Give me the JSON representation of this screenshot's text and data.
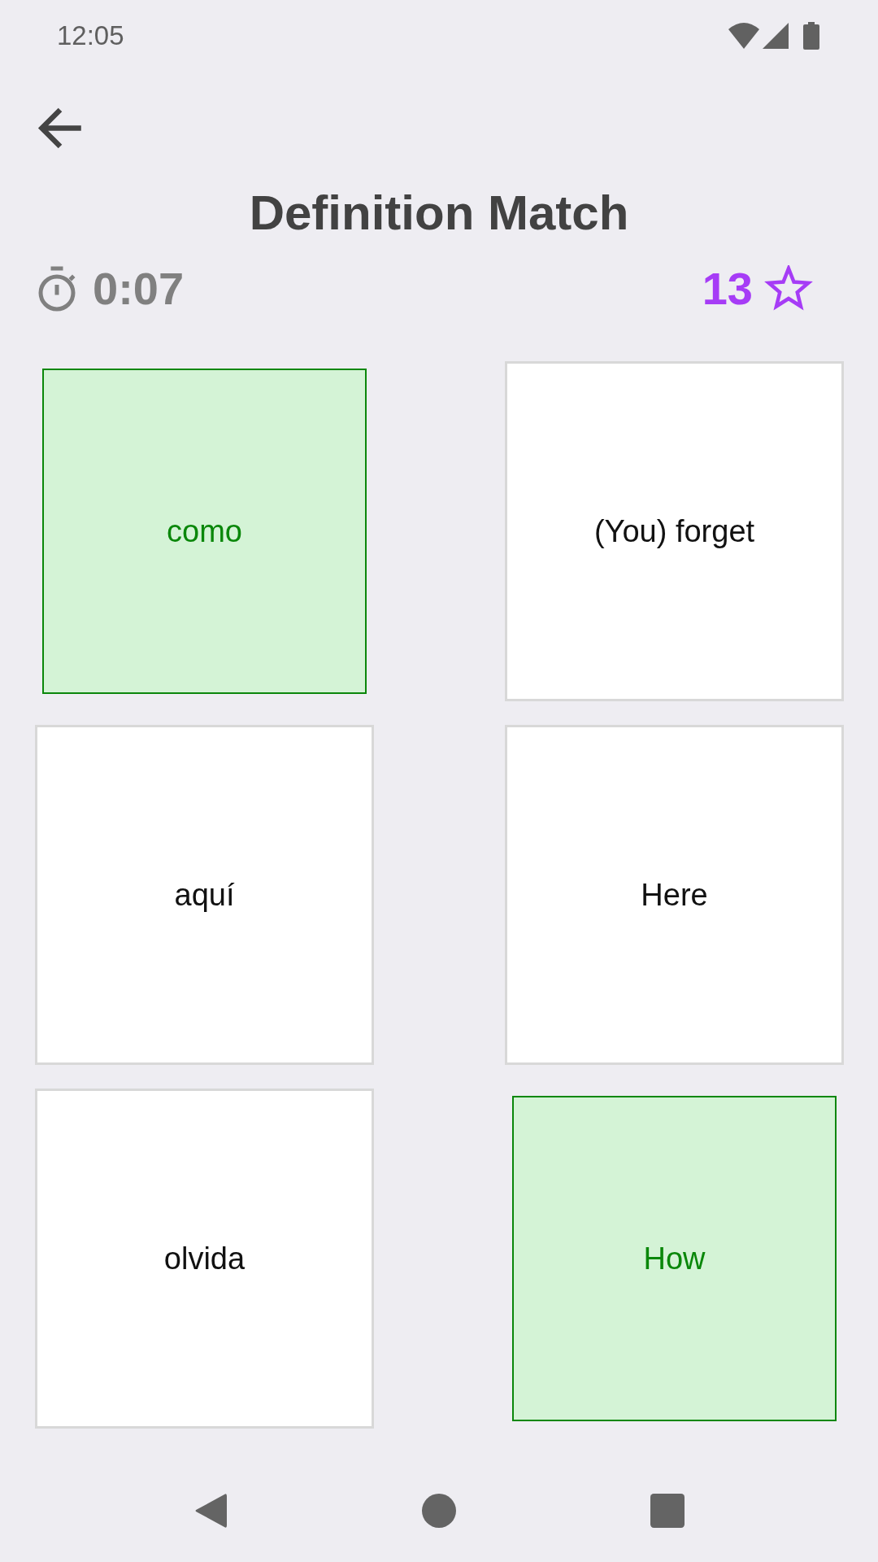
{
  "status_bar": {
    "time": "12:05"
  },
  "header": {
    "title": "Definition Match"
  },
  "stats": {
    "timer": "0:07",
    "score": "13"
  },
  "cards": [
    {
      "label": "como",
      "selected": true
    },
    {
      "label": "(You) forget",
      "selected": false
    },
    {
      "label": "aquí",
      "selected": false
    },
    {
      "label": "Here",
      "selected": false
    },
    {
      "label": "olvida",
      "selected": false
    },
    {
      "label": "How",
      "selected": true
    }
  ]
}
